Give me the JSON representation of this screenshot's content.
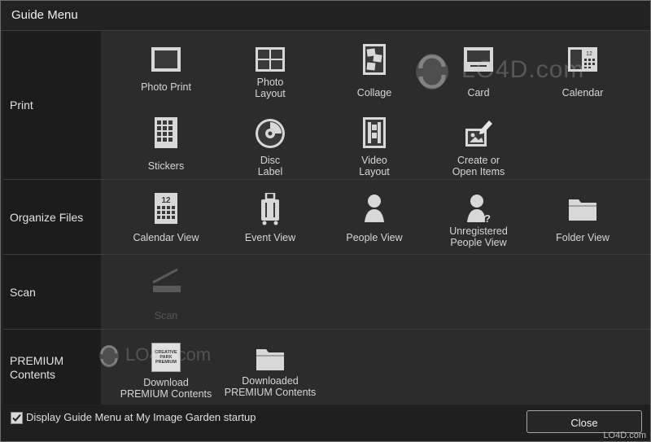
{
  "window": {
    "title": "Guide Menu"
  },
  "sections": {
    "print": {
      "label": "Print",
      "items": [
        "Photo Print",
        "Photo\nLayout",
        "Collage",
        "Card",
        "Calendar",
        "Stickers",
        "Disc\nLabel",
        "Video\nLayout",
        "Create or\nOpen Items"
      ]
    },
    "organize": {
      "label": "Organize Files",
      "items": [
        "Calendar View",
        "Event View",
        "People View",
        "Unregistered\nPeople View",
        "Folder View"
      ]
    },
    "scan": {
      "label": "Scan",
      "items": [
        "Scan"
      ]
    },
    "premium": {
      "label": "PREMIUM\nContents",
      "items": [
        "Download\nPREMIUM Contents",
        "Downloaded\nPREMIUM Contents"
      ],
      "badge_text": [
        "CREATIVE",
        "PARK",
        "PREMIUM"
      ]
    }
  },
  "calendar_icon_number": "12",
  "footer": {
    "startup_checkbox_label": "Display Guide Menu at My Image Garden startup",
    "startup_checked": true,
    "close_label": "Close"
  },
  "watermarks": {
    "main": "LO4D.com",
    "secondary": "LO4D.com",
    "corner": "LO4D.com"
  }
}
